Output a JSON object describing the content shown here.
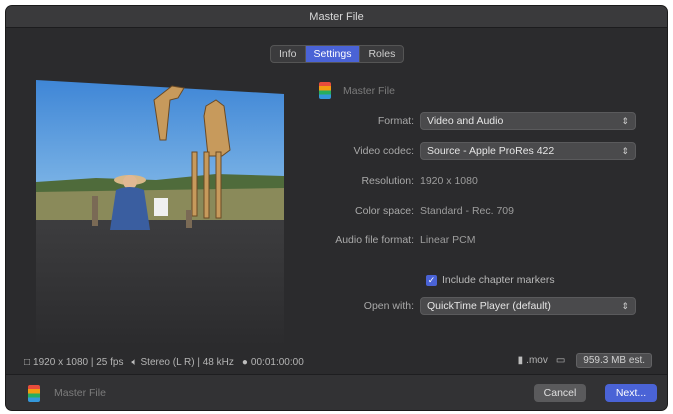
{
  "window": {
    "title": "Master File"
  },
  "tabs": [
    {
      "label": "Info",
      "active": false
    },
    {
      "label": "Settings",
      "active": true
    },
    {
      "label": "Roles",
      "active": false
    }
  ],
  "file": {
    "name": "Master File"
  },
  "settings": {
    "format": {
      "label": "Format:",
      "value": "Video and Audio"
    },
    "video_codec": {
      "label": "Video codec:",
      "value": "Source - Apple ProRes 422"
    },
    "resolution": {
      "label": "Resolution:",
      "value": "1920 x 1080"
    },
    "color_space": {
      "label": "Color space:",
      "value": "Standard - Rec. 709"
    },
    "audio_format": {
      "label": "Audio file format:",
      "value": "Linear PCM"
    },
    "chapter_markers": {
      "label": "Include chapter markers",
      "checked": true
    },
    "open_with": {
      "label": "Open with:",
      "value": "QuickTime Player (default)"
    }
  },
  "info": {
    "video": "1920 x 1080 | 25 fps",
    "audio": "Stereo (L R) | 48 kHz",
    "duration": "00:01:00:00",
    "extension": ".mov",
    "size": "959.3 MB est."
  },
  "footer": {
    "file_name": "Master File",
    "cancel_label": "Cancel",
    "next_label": "Next..."
  },
  "colors": {
    "accent": "#4a63d6",
    "background": "#2b2b2d"
  }
}
